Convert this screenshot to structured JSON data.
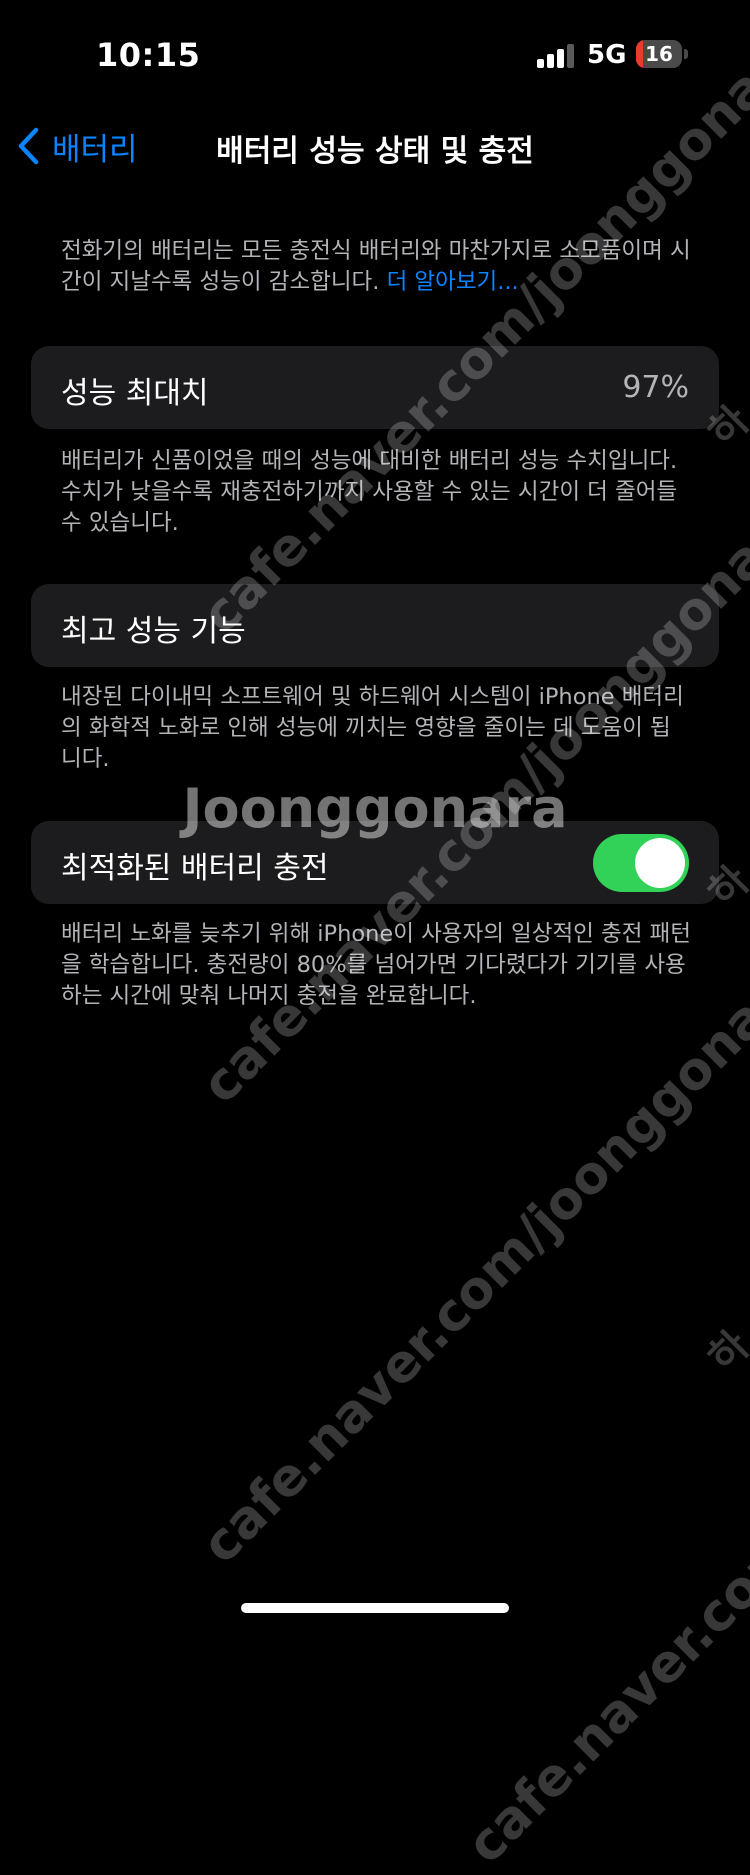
{
  "status_bar": {
    "time": "10:15",
    "network": "5G",
    "battery_level": "16",
    "battery_fraction": 0.16,
    "signal_bars_filled": 3,
    "signal_bars_total": 4
  },
  "nav": {
    "back_label": "배터리",
    "back_icon": "chevron-left-icon",
    "title": "배터리 성능 상태 및 충전"
  },
  "intro": {
    "text": "전화기의 배터리는 모든 충전식 배터리와 마찬가지로 소모품이며 시간이 지날수록 성능이 감소합니다. ",
    "link": "더 알아보기..."
  },
  "maximum_capacity": {
    "label": "성능 최대치",
    "value": "97%",
    "description": "배터리가 신품이었을 때의 성능에 대비한 배터리 성능 수치입니다. 수치가 낮을수록 재충전하기까지 사용할 수 있는 시간이 더 줄어들 수 있습니다."
  },
  "peak_performance": {
    "label": "최고 성능 기능",
    "description": "내장된 다이내믹 소프트웨어 및 하드웨어 시스템이 iPhone 배터리의 화학적 노화로 인해 성능에 끼치는 영향을 줄이는 데 도움이 됩니다."
  },
  "optimized_charging": {
    "label": "최적화된 배터리 충전",
    "enabled": true,
    "description": "배터리 노화를 늦추기 위해 iPhone이 사용자의 일상적인 충전 패턴을 학습합니다. 충전량이 80%를 넘어가면 기다렸다가 기기를 사용하는 시간에 맞춰 나머지 충전을 완료합니다."
  },
  "watermark": {
    "url": "cafe.naver.com/joonggonara",
    "brand": "Joonggonara",
    "side": "하"
  },
  "colors": {
    "accent": "#0a84ff",
    "toggle_on": "#32d158",
    "battery_low": "#eb3b2f",
    "card_bg": "#1c1c1e"
  }
}
